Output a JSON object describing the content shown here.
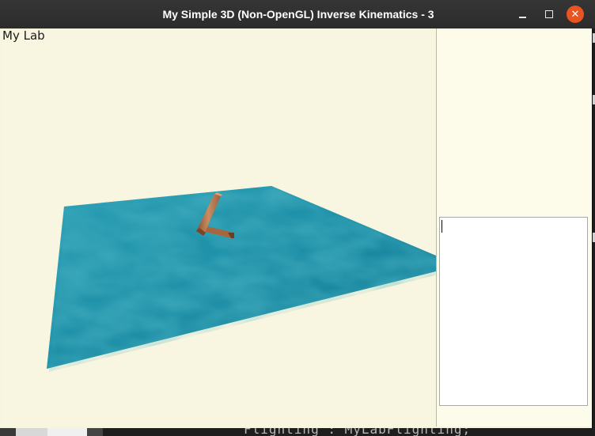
{
  "window": {
    "title": "My Simple 3D (Non-OpenGL) Inverse Kinematics - 3",
    "controls": {
      "minimize": "minimize-icon",
      "maximize": "maximize-icon",
      "close": "close-icon",
      "close_symbol": "✕"
    }
  },
  "viewport": {
    "label": "My Lab",
    "colors": {
      "background": "#f8f6e0",
      "water": "#1e8fa6",
      "water_dark": "#0f5e73",
      "arm": "#b0704a"
    }
  },
  "side_panel": {
    "text_area_value": ""
  },
  "background_terminal": {
    "text": "Flighting : MyLabFlighting;"
  }
}
